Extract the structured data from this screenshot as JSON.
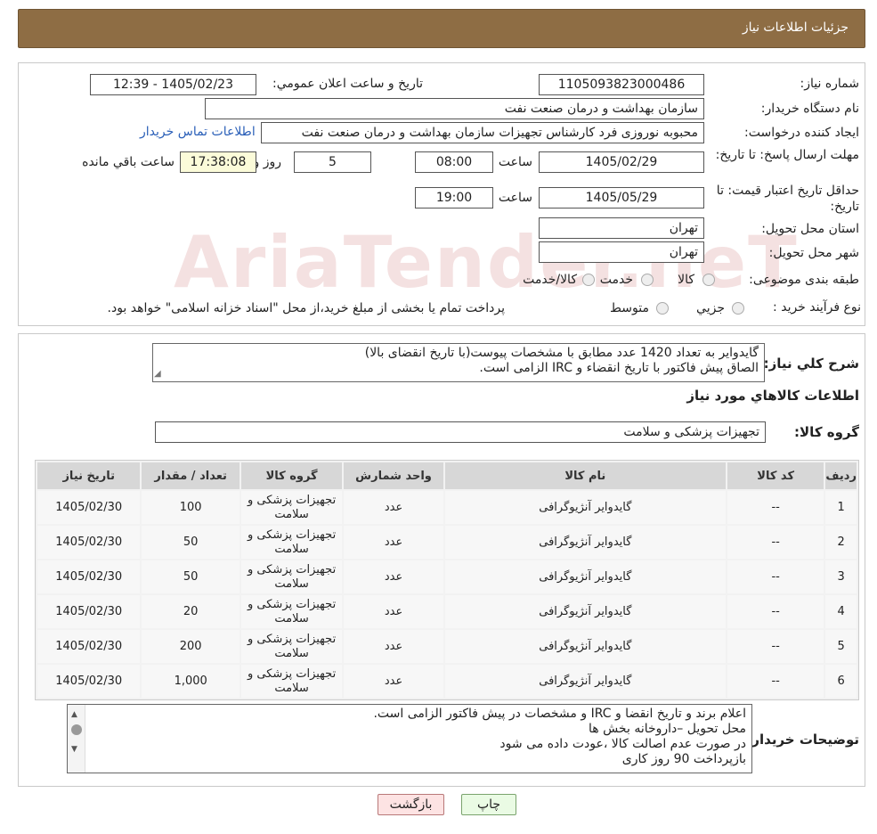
{
  "header": {
    "title": "جزئیات اطلاعات نیاز"
  },
  "fields": {
    "need_number_label": "شماره نیاز:",
    "need_number": "1105093823000486",
    "announce_label": "تاریخ و ساعت اعلان عمومي:",
    "announce_value": "1405/02/23 - 12:39",
    "buyer_org_label": "نام دستگاه خریدار:",
    "buyer_org": "سازمان بهداشت و درمان صنعت نفت",
    "creator_label": "ایجاد کننده درخواست:",
    "creator": "محبوبه نوروزی فرد کارشناس تجهیزات سازمان بهداشت و درمان صنعت نفت",
    "contact_link": "اطلاعات تماس خریدار",
    "deadline_label": "مهلت ارسال پاسخ: تا تاریخ:",
    "deadline_date": "1405/02/29",
    "time_label": "ساعت",
    "deadline_time": "08:00",
    "days_value": "5",
    "days_label": "روز و",
    "remaining_time": "17:38:08",
    "remaining_label": "ساعت باقي مانده",
    "validity_label": "حداقل تاریخ اعتبار قیمت: تا تاریخ:",
    "validity_date": "1405/05/29",
    "validity_time": "19:00",
    "province_label": "استان محل تحویل:",
    "province": "تهران",
    "city_label": "شهر محل تحویل:",
    "city": "تهران",
    "category_label": "طبقه بندی موضوعی:",
    "category_options": [
      "کالا",
      "خدمت",
      "کالا/خدمت"
    ],
    "process_label": "نوع فرآیند خرید :",
    "process_options": [
      "جزيي",
      "متوسط"
    ],
    "process_note": "پرداخت تمام یا بخشی از مبلغ خرید،از محل \"اسناد خزانه اسلامی\" خواهد بود."
  },
  "description": {
    "label": "شرح کلي نیاز:",
    "line1": "گایدوایر به تعداد 1420 عدد مطابق با مشخصات پیوست(با تاریخ انقضای بالا)",
    "line2": "الصاق پیش فاکتور با تاریخ انقضاء و IRC الزامی است."
  },
  "goods_info_title": "اطلاعات کالاهاي مورد نیاز",
  "goods_group": {
    "label": "گروه کالا:",
    "value": "تجهیزات پزشکی و سلامت"
  },
  "table": {
    "headers": [
      "ردیف",
      "کد کالا",
      "نام کالا",
      "واحد شمارش",
      "گروه کالا",
      "تعداد / مقدار",
      "تاریخ نیاز"
    ],
    "rows": [
      {
        "n": "1",
        "code": "--",
        "name": "گایدوایر آنژیوگرافی",
        "unit": "عدد",
        "group": "تجهیزات پزشکی و سلامت",
        "qty": "100",
        "date": "1405/02/30"
      },
      {
        "n": "2",
        "code": "--",
        "name": "گایدوایر آنژیوگرافی",
        "unit": "عدد",
        "group": "تجهیزات پزشکی و سلامت",
        "qty": "50",
        "date": "1405/02/30"
      },
      {
        "n": "3",
        "code": "--",
        "name": "گایدوایر آنژیوگرافی",
        "unit": "عدد",
        "group": "تجهیزات پزشکی و سلامت",
        "qty": "50",
        "date": "1405/02/30"
      },
      {
        "n": "4",
        "code": "--",
        "name": "گایدوایر آنژیوگرافی",
        "unit": "عدد",
        "group": "تجهیزات پزشکی و سلامت",
        "qty": "20",
        "date": "1405/02/30"
      },
      {
        "n": "5",
        "code": "--",
        "name": "گایدوایر آنژیوگرافی",
        "unit": "عدد",
        "group": "تجهیزات پزشکی و سلامت",
        "qty": "200",
        "date": "1405/02/30"
      },
      {
        "n": "6",
        "code": "--",
        "name": "گایدوایر آنژیوگرافی",
        "unit": "عدد",
        "group": "تجهیزات پزشکی و سلامت",
        "qty": "1,000",
        "date": "1405/02/30"
      }
    ]
  },
  "buyer_notes": {
    "label": "توضیحات خریدار:",
    "lines": [
      "اعلام برند و تاریخ انقضا  و IRC  و مشخصات در پیش فاکتور الزامی است.",
      "محل تحویل –داروخانه بخش ها",
      "در صورت عدم اصالت کالا ،عودت داده می شود",
      "بازپرداخت 90 روز کاری"
    ]
  },
  "buttons": {
    "print": "چاپ",
    "back": "بازگشت"
  },
  "watermark": "AriaTender.neT"
}
